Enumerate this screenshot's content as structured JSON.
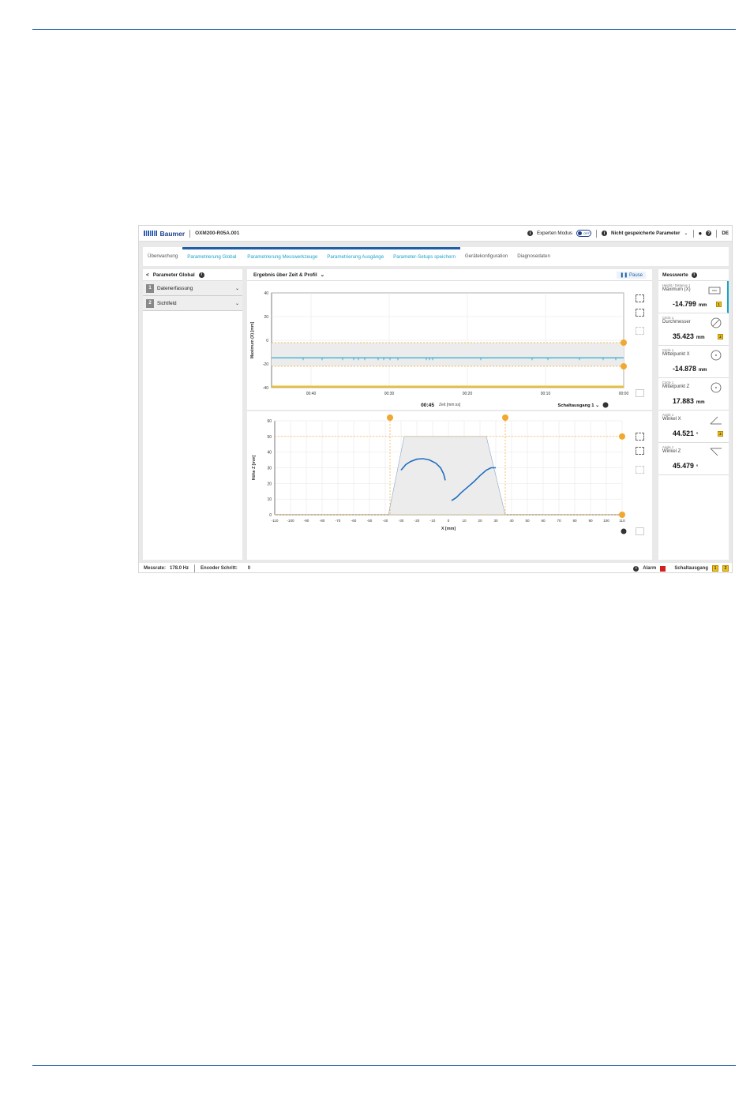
{
  "app": {
    "brand": "Baumer",
    "device": "OXM200-R05A.001",
    "expert_mode_label": "Experten Modus",
    "toggle_text": "OFF",
    "unsaved_label": "Nicht gespeicherte Parameter",
    "language": "DE"
  },
  "tabs": [
    {
      "label": "Überwachung"
    },
    {
      "label": "Parametrierung Global"
    },
    {
      "label": "Parametrierung Messwerkzeuge"
    },
    {
      "label": "Parametrierung Ausgänge"
    },
    {
      "label": "Parameter-Setups speichern"
    },
    {
      "label": "Gerätekonfiguration"
    },
    {
      "label": "Diagnosedaten"
    }
  ],
  "left_panel": {
    "back": "<",
    "title": "Parameter Global",
    "items": [
      {
        "num": "1",
        "label": "Datenerfassung"
      },
      {
        "num": "2",
        "label": "Sichtfeld"
      }
    ]
  },
  "center_panel": {
    "view_select": "Ergebnis über Zeit & Profil",
    "pause_label": "Pause",
    "time_value": "00:45",
    "time_axis_label": "Zeit [mm:ss]",
    "output_select": "Schaltausgang 1"
  },
  "chart_data": [
    {
      "type": "line",
      "ylabel": "Maximum (X) [mm]",
      "xlabel": "Zeit [mm:ss]",
      "ylim": [
        -40,
        40
      ],
      "yticks": [
        "40",
        "20",
        "0",
        "-20",
        "-40"
      ],
      "xticks": [
        "00:40",
        "00:30",
        "00:20",
        "00:10",
        "00:00"
      ],
      "series": [
        {
          "values_mm": -14.8,
          "color": "#1aa3c8"
        }
      ],
      "upper_limit": -2,
      "lower_limit": -22,
      "grid": true
    },
    {
      "type": "scatter",
      "ylabel": "Höhe Z [mm]",
      "xlabel": "X [mm]",
      "xlim": [
        -110,
        110
      ],
      "ylim": [
        0,
        60
      ],
      "xticks": [
        "-110",
        "-100",
        "-90",
        "-80",
        "-70",
        "-60",
        "-50",
        "-40",
        "-30",
        "-20",
        "-10",
        "0",
        "10",
        "20",
        "30",
        "40",
        "50",
        "60",
        "70",
        "80",
        "90",
        "100",
        "110"
      ],
      "yticks": [
        "60",
        "50",
        "40",
        "30",
        "20",
        "10",
        "0"
      ],
      "field_of_view": {
        "x": [
          -38,
          -28,
          24,
          36
        ],
        "z_top": 50
      },
      "vertical_limits": [
        -37,
        36
      ],
      "horizontal_limit": 50,
      "profile_arc": [
        [
          -30,
          28.5
        ],
        [
          -27,
          32
        ],
        [
          -24,
          34
        ],
        [
          -20,
          35.5
        ],
        [
          -16,
          35.8
        ],
        [
          -12,
          35
        ],
        [
          -8,
          33
        ],
        [
          -5,
          30
        ],
        [
          -3,
          26
        ],
        [
          -2,
          22
        ]
      ],
      "profile_line": [
        [
          2,
          9
        ],
        [
          5,
          11
        ],
        [
          8,
          14
        ],
        [
          12,
          17.5
        ],
        [
          16,
          21
        ],
        [
          20,
          25
        ],
        [
          24,
          28.5
        ],
        [
          27,
          30
        ],
        [
          30,
          30
        ]
      ],
      "grid": true
    }
  ],
  "right_panel": {
    "title": "Messwerte",
    "cards": [
      {
        "sub": "Height / Distance 1",
        "name": "Maximum (X)",
        "value": "-14.799",
        "unit": "mm",
        "badge": "1"
      },
      {
        "sub": "Circle 1",
        "name": "Durchmesser",
        "value": "35.423",
        "unit": "mm",
        "badge": "2"
      },
      {
        "sub": "Circle 1",
        "name": "Mittelpunkt X",
        "value": "-14.878",
        "unit": "mm",
        "badge": ""
      },
      {
        "sub": "Circle 1",
        "name": "Mittelpunkt Z",
        "value": "17.883",
        "unit": "mm",
        "badge": ""
      },
      {
        "sub": "Angle 1",
        "name": "Winkel X",
        "value": "44.521",
        "unit": "°",
        "badge": "2"
      },
      {
        "sub": "Angle 1",
        "name": "Winkel Z",
        "value": "45.479",
        "unit": "°",
        "badge": ""
      }
    ]
  },
  "status": {
    "rate_label": "Messrate:",
    "rate_value": "178.0 Hz",
    "encoder_label": "Encoder Schritt:",
    "encoder_value": "0",
    "alarm_label": "Alarm",
    "output_label": "Schaltausgang",
    "out1": "1",
    "out2": "2"
  },
  "colors": {
    "accent": "#1aa3c8",
    "limit": "#f0a830",
    "alarm": "#d0201f",
    "output": "#f2c21a"
  }
}
